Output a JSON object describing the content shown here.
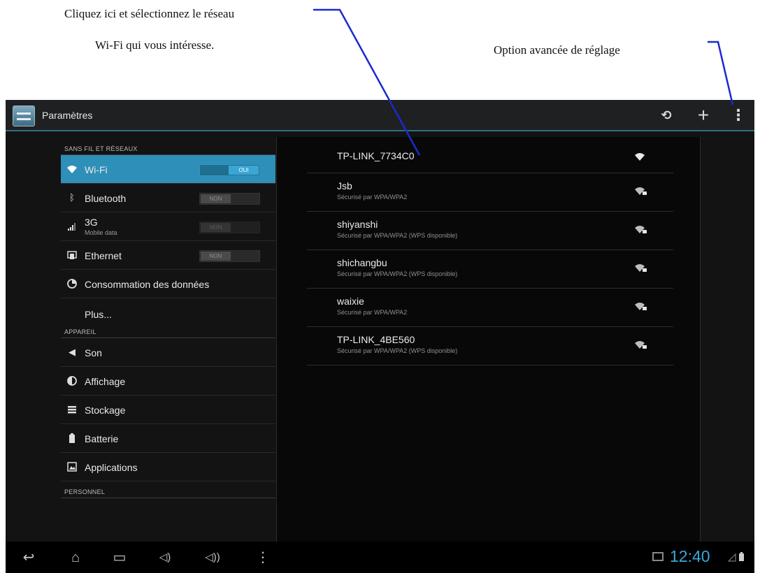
{
  "annotations": {
    "select_network_line1": "Cliquez ici et sélectionnez le réseau",
    "select_network_line2": "Wi-Fi qui vous intéresse.",
    "advanced_option": "Option avancée de réglage"
  },
  "actionbar": {
    "title": "Paramètres",
    "scan_icon": "wifi-scan-icon",
    "scan_glyph": "⟲",
    "add_icon": "add-icon",
    "add_glyph": "+",
    "overflow_icon": "overflow-menu-icon",
    "overflow_glyph": "⋮"
  },
  "sections": {
    "wireless": "SANS FIL ET RÉSEAUX",
    "device": "APPAREIL",
    "personal": "PERSONNEL"
  },
  "settings": {
    "wifi": {
      "label": "Wi-Fi",
      "toggle": "OUI",
      "state": "on",
      "icon": "wifi-icon"
    },
    "bluetooth": {
      "label": "Bluetooth",
      "toggle": "NON",
      "state": "off",
      "icon": "bluetooth-icon"
    },
    "mobile": {
      "label": "3G",
      "sub": "Mobile data",
      "toggle": "NON",
      "state": "off-disabled",
      "icon": "signal-bars-icon"
    },
    "ethernet": {
      "label": "Ethernet",
      "toggle": "NON",
      "state": "off",
      "icon": "ethernet-icon"
    },
    "data_usage": {
      "label": "Consommation des données",
      "icon": "data-usage-icon"
    },
    "more": {
      "label": "Plus..."
    },
    "sound": {
      "label": "Son",
      "icon": "speaker-icon"
    },
    "display": {
      "label": "Affichage",
      "icon": "brightness-icon"
    },
    "storage": {
      "label": "Stockage",
      "icon": "storage-icon"
    },
    "battery": {
      "label": "Batterie",
      "icon": "battery-icon"
    },
    "apps": {
      "label": "Applications",
      "icon": "apps-icon"
    }
  },
  "networks": [
    {
      "name": "TP-LINK_7734C0",
      "status": "",
      "secured": false
    },
    {
      "name": "Jsb",
      "status": "Sécurisé par WPA/WPA2",
      "secured": true
    },
    {
      "name": "shiyanshi",
      "status": "Sécurisé par WPA/WPA2 (WPS disponible)",
      "secured": true
    },
    {
      "name": "shichangbu",
      "status": "Sécurisé par WPA/WPA2 (WPS disponible)",
      "secured": true
    },
    {
      "name": "waixie",
      "status": "Sécurisé par WPA/WPA2",
      "secured": true
    },
    {
      "name": "TP-LINK_4BE560",
      "status": "Sécurisé par WPA/WPA2 (WPS disponible)",
      "secured": true
    }
  ],
  "navbar": {
    "back": "↩",
    "home": "⌂",
    "recents": "▭",
    "vol_down": "◁)",
    "vol_up": "◁))",
    "menu": "⋮",
    "clock": "12:40"
  },
  "colors": {
    "accent": "#33b5e5",
    "selected_row": "#2e8fb9",
    "background": "#131313"
  }
}
